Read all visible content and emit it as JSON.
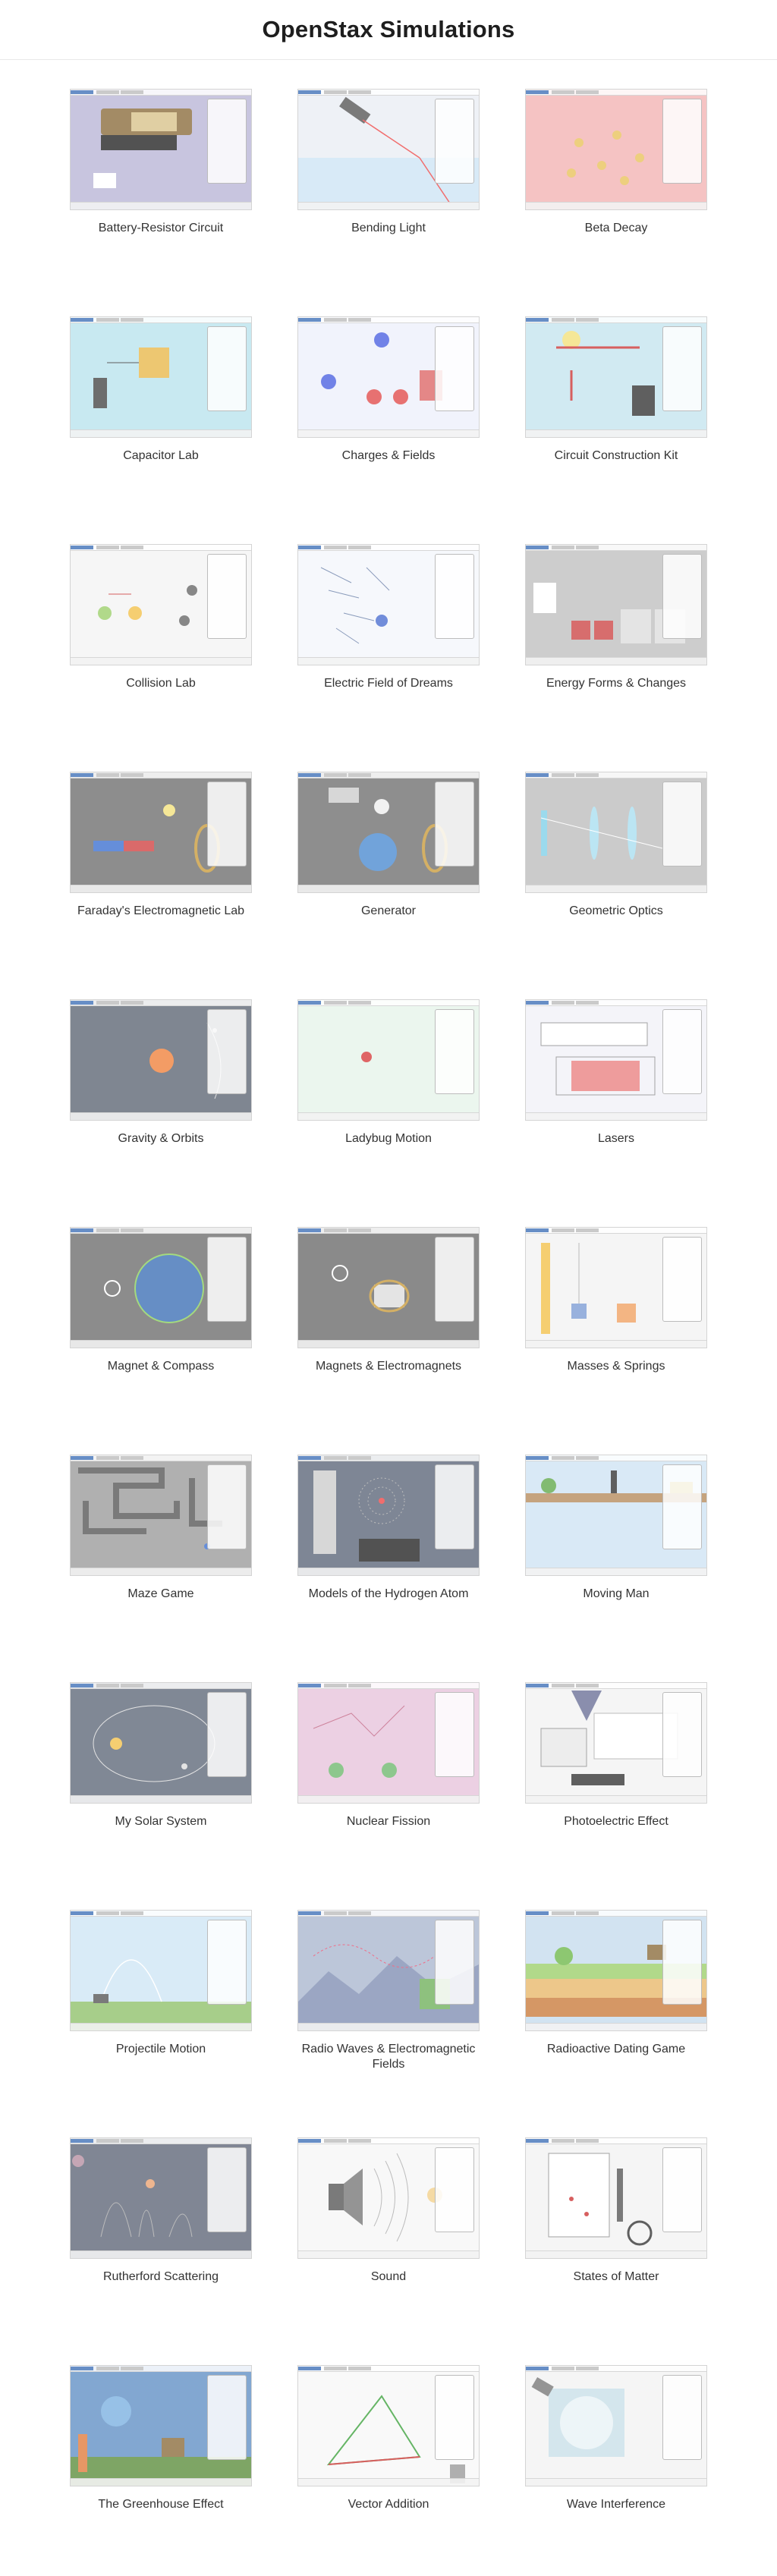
{
  "page": {
    "title": "OpenStax Simulations"
  },
  "simulations": [
    {
      "title": "Battery-Resistor Circuit",
      "icon": "battery-circuit-icon",
      "bg": "#b9b5d6"
    },
    {
      "title": "Bending Light",
      "icon": "laser-refraction-icon",
      "bg": "#e9eef4"
    },
    {
      "title": "Beta Decay",
      "icon": "nucleus-icon",
      "bg": "#f2b3b3"
    },
    {
      "title": "Capacitor Lab",
      "icon": "capacitor-icon",
      "bg": "#b9e3ee"
    },
    {
      "title": "Charges & Fields",
      "icon": "charges-icon",
      "bg": "#eef0fb"
    },
    {
      "title": "Circuit Construction Kit",
      "icon": "circuit-kit-icon",
      "bg": "#c5e5ef"
    },
    {
      "title": "Collision Lab",
      "icon": "collision-icon",
      "bg": "#f4f4f4"
    },
    {
      "title": "Electric Field of Dreams",
      "icon": "electric-field-icon",
      "bg": "#f4f7fc"
    },
    {
      "title": "Energy Forms & Changes",
      "icon": "energy-icon",
      "bg": "#bfbfbf"
    },
    {
      "title": "Faraday's Electromagnetic Lab",
      "icon": "magnet-coil-icon",
      "bg": "#6d6d6d"
    },
    {
      "title": "Generator",
      "icon": "generator-icon",
      "bg": "#6f6f6f"
    },
    {
      "title": "Geometric Optics",
      "icon": "lens-icon",
      "bg": "#bdbdbd"
    },
    {
      "title": "Gravity & Orbits",
      "icon": "orbit-icon",
      "bg": "#5c6573"
    },
    {
      "title": "Ladybug Motion",
      "icon": "ladybug-icon",
      "bg": "#e6f4ea"
    },
    {
      "title": "Lasers",
      "icon": "laser-icon",
      "bg": "#f1f1f8"
    },
    {
      "title": "Magnet & Compass",
      "icon": "compass-icon",
      "bg": "#6c6c6c"
    },
    {
      "title": "Magnets & Electromagnets",
      "icon": "electromagnet-icon",
      "bg": "#6a6a6a"
    },
    {
      "title": "Masses & Springs",
      "icon": "spring-icon",
      "bg": "#f3f3f3"
    },
    {
      "title": "Maze Game",
      "icon": "maze-icon",
      "bg": "#9a9a9a"
    },
    {
      "title": "Models of the Hydrogen Atom",
      "icon": "atom-icon",
      "bg": "#5a6578"
    },
    {
      "title": "Moving Man",
      "icon": "moving-man-icon",
      "bg": "#cfe3f4"
    },
    {
      "title": "My Solar System",
      "icon": "solar-system-icon",
      "bg": "#5d6778"
    },
    {
      "title": "Nuclear Fission",
      "icon": "fission-icon",
      "bg": "#e7c3dc"
    },
    {
      "title": "Photoelectric Effect",
      "icon": "photoelectric-icon",
      "bg": "#f2f2f2"
    },
    {
      "title": "Projectile Motion",
      "icon": "cannon-icon",
      "bg": "#cfe6f5"
    },
    {
      "title": "Radio Waves & Electromagnetic Fields",
      "icon": "radio-wave-icon",
      "bg": "#a9b6cf"
    },
    {
      "title": "Radioactive Dating Game",
      "icon": "dating-icon",
      "bg": "#c6dcee"
    },
    {
      "title": "Rutherford Scattering",
      "icon": "scattering-icon",
      "bg": "#5d6577"
    },
    {
      "title": "Sound",
      "icon": "speaker-icon",
      "bg": "#f6f6f6"
    },
    {
      "title": "States of Matter",
      "icon": "matter-icon",
      "bg": "#f3f3f3"
    },
    {
      "title": "The Greenhouse Effect",
      "icon": "greenhouse-icon",
      "bg": "#5f8fc4"
    },
    {
      "title": "Vector Addition",
      "icon": "vector-icon",
      "bg": "#f8f8f8"
    },
    {
      "title": "Wave Interference",
      "icon": "wave-icon",
      "bg": "#f2f2f2"
    }
  ]
}
